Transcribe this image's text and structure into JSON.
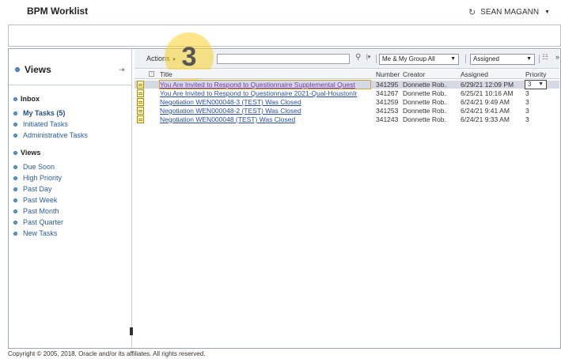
{
  "app": {
    "title": "BPM Worklist",
    "user": "SEAN MAGANN"
  },
  "left": {
    "views_header": "Views",
    "inbox_title": "Inbox",
    "inbox_items": [
      "My Tasks (5)",
      "Initiated Tasks",
      "Administrative Tasks"
    ],
    "views_title": "Views",
    "view_items": [
      "Due Soon",
      "High Priority",
      "Past Day",
      "Past Week",
      "Past Month",
      "Past Quarter",
      "New Tasks"
    ]
  },
  "toolbar": {
    "actions_label": "Actions",
    "search_value": "",
    "filter_value": "Me & My Group All",
    "status_value": "Assigned",
    "more_label": "»",
    "step_badge": "3"
  },
  "columns": {
    "title": "Title",
    "number": "Number",
    "creator": "Creator",
    "assigned": "Assigned",
    "priority": "Priority"
  },
  "rows": [
    {
      "title": "You Are Invited to Respond to Questionnaire Supplemental Quest",
      "number": "341295",
      "creator": "Donnette Rob...",
      "assigned": "6/29/21 12:09 PM",
      "priority": "3"
    },
    {
      "title": "You Are Invited to Respond to Questionnaire 2021-Qual-HoustonIr",
      "number": "341267",
      "creator": "Donnette Rob...",
      "assigned": "6/25/21 10:16 AM",
      "priority": "3"
    },
    {
      "title": "Negotiation WEN000048-3 (TEST) Was Closed",
      "number": "341259",
      "creator": "Donnette Rob...",
      "assigned": "6/24/21 9:49 AM",
      "priority": "3"
    },
    {
      "title": "Negotiation WEN000048-2 (TEST) Was Closed",
      "number": "341253",
      "creator": "Donnette Rob...",
      "assigned": "6/24/21 9:41 AM",
      "priority": "3"
    },
    {
      "title": "Negotiation WEN000048 (TEST) Was Closed",
      "number": "341243",
      "creator": "Donnette Rob...",
      "assigned": "6/24/21 9:33 AM",
      "priority": "3"
    }
  ],
  "footer": "Copyright © 2005, 2018, Oracle and/or its affiliates. All rights reserved."
}
